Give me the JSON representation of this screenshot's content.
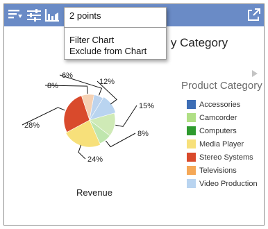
{
  "toolbar": {
    "icons": [
      "sort-icon",
      "filter-sliders-icon",
      "chart-type-icon",
      "expand-icon"
    ]
  },
  "chart": {
    "title_visible": "y Category",
    "measure_label": "Revenue"
  },
  "legend": {
    "title": "Product Category",
    "items": [
      {
        "label": "Accessories",
        "color": "#3d6db5"
      },
      {
        "label": "Camcorder",
        "color": "#b0df85"
      },
      {
        "label": "Computers",
        "color": "#2e9a2e"
      },
      {
        "label": "Media Player",
        "color": "#f7e07a"
      },
      {
        "label": "Stereo Systems",
        "color": "#d94a2c"
      },
      {
        "label": "Televisions",
        "color": "#f5a857"
      },
      {
        "label": "Video Production",
        "color": "#b9d4f0"
      }
    ]
  },
  "context_menu": {
    "header": "2 points",
    "items": [
      "Filter Chart",
      "Exclude from Chart"
    ]
  },
  "chart_data": {
    "type": "pie",
    "title": "",
    "slices": [
      {
        "name": "Video Production",
        "label": "12%",
        "value": 12,
        "color": "#b9d4f0",
        "selected": true
      },
      {
        "name": "Camcorder",
        "label": "15%",
        "value": 15,
        "color": "#cfeab6",
        "selected": false
      },
      {
        "name": "Computers",
        "label": "8%",
        "value": 8,
        "color": "#bfe6ad",
        "selected": false
      },
      {
        "name": "Media Player",
        "label": "24%",
        "value": 24,
        "color": "#f7e07a",
        "selected": true
      },
      {
        "name": "Stereo Systems",
        "label": "28%",
        "value": 28,
        "color": "#d94a2c",
        "selected": false
      },
      {
        "name": "Televisions",
        "label": "8%",
        "value": 8,
        "color": "#f5d1b3",
        "selected": false
      },
      {
        "name": "Accessories",
        "label": "6%",
        "value": 6,
        "color": "#bcd3ee",
        "selected": false
      }
    ]
  }
}
